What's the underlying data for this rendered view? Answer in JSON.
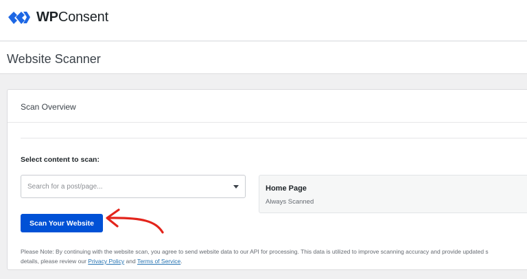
{
  "brand": {
    "name_bold": "WP",
    "name_rest": "Consent",
    "logo_icon": "wpconsent-logo-icon",
    "color": "#1d67e4"
  },
  "header": {
    "title": "Website Scanner"
  },
  "card": {
    "title": "Scan Overview",
    "select_label": "Select content to scan:",
    "search": {
      "placeholder": "Search for a post/page...",
      "value": ""
    },
    "home_page": {
      "title": "Home Page",
      "subtitle": "Always Scanned"
    },
    "scan_button": {
      "label": "Scan Your Website",
      "color": "#0051d6"
    },
    "note": {
      "line1": "Please Note: By continuing with the website scan, you agree to send website data to our API for processing. This data is utilized to improve scanning accuracy and provide updated s",
      "line2_pre": "details, please review our ",
      "privacy_link": "Privacy Policy",
      "and": " and ",
      "terms_link": "Terms of Service",
      "end": "."
    }
  },
  "annotation": {
    "icon": "red-arrow-icon",
    "color": "#e3241b"
  }
}
